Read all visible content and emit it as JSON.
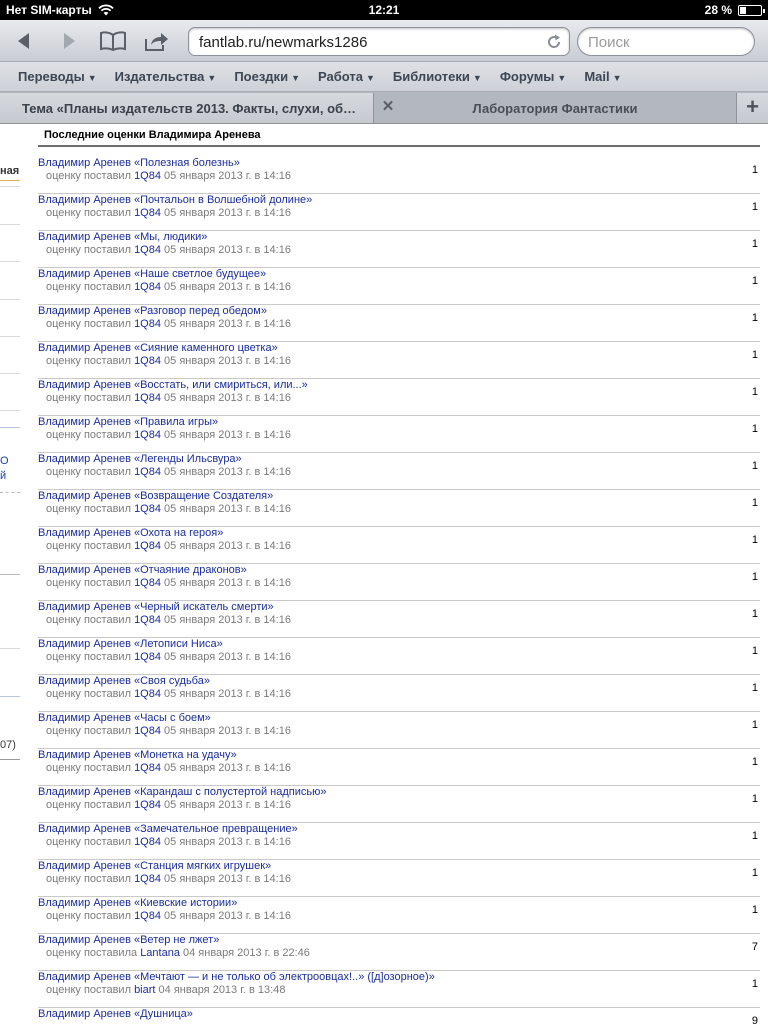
{
  "statusbar": {
    "carrier": "Нет SIM-карты",
    "time": "12:21",
    "battery_text": "28 %",
    "battery_level": 0.28
  },
  "toolbar": {
    "url": "fantlab.ru/newmarks1286",
    "search_placeholder": "Поиск",
    "icons": [
      "back-arrow-icon",
      "forward-arrow-icon",
      "bookmarks-book-icon",
      "share-icon",
      "reload-icon"
    ]
  },
  "bookmarks": [
    {
      "label": "Переводы",
      "caret": "▼"
    },
    {
      "label": "Издательства",
      "caret": "▼"
    },
    {
      "label": "Поездки",
      "caret": "▼"
    },
    {
      "label": "Работа",
      "caret": "▼"
    },
    {
      "label": "Библиотеки",
      "caret": "▼"
    },
    {
      "label": "Форумы",
      "caret": "▼"
    },
    {
      "label": "Mail",
      "caret": "▼"
    }
  ],
  "tabs": {
    "active": "Тема «Планы издательств 2013. Факты, слухи, об…",
    "other": "Лаборатория Фантастики",
    "close_glyph": "✕",
    "add_glyph": "+"
  },
  "left_fragments": {
    "label_top": "ная",
    "label_blue_1": "О",
    "label_blue_2": "й",
    "label_bottom": "07)"
  },
  "main": {
    "heading": "Последние оценки Владимира Аренева",
    "rows": [
      {
        "title": "Владимир Аренев «Полезная болезнь»",
        "prefix": "оценку поставил",
        "user": "1Q84",
        "date": "05 января 2013 г. в 14:16",
        "score": "1"
      },
      {
        "title": "Владимир Аренев «Почтальон в Волшебной долине»",
        "prefix": "оценку поставил",
        "user": "1Q84",
        "date": "05 января 2013 г. в 14:16",
        "score": "1"
      },
      {
        "title": "Владимир Аренев «Мы, людики»",
        "prefix": "оценку поставил",
        "user": "1Q84",
        "date": "05 января 2013 г. в 14:16",
        "score": "1"
      },
      {
        "title": "Владимир Аренев «Наше светлое будущее»",
        "prefix": "оценку поставил",
        "user": "1Q84",
        "date": "05 января 2013 г. в 14:16",
        "score": "1"
      },
      {
        "title": "Владимир Аренев «Разговор перед обедом»",
        "prefix": "оценку поставил",
        "user": "1Q84",
        "date": "05 января 2013 г. в 14:16",
        "score": "1"
      },
      {
        "title": "Владимир Аренев «Сияние каменного цветка»",
        "prefix": "оценку поставил",
        "user": "1Q84",
        "date": "05 января 2013 г. в 14:16",
        "score": "1"
      },
      {
        "title": "Владимир Аренев «Восстать, или смириться, или...»",
        "prefix": "оценку поставил",
        "user": "1Q84",
        "date": "05 января 2013 г. в 14:16",
        "score": "1"
      },
      {
        "title": "Владимир Аренев «Правила игры»",
        "prefix": "оценку поставил",
        "user": "1Q84",
        "date": "05 января 2013 г. в 14:16",
        "score": "1"
      },
      {
        "title": "Владимир Аренев «Легенды Ильсвура»",
        "prefix": "оценку поставил",
        "user": "1Q84",
        "date": "05 января 2013 г. в 14:16",
        "score": "1"
      },
      {
        "title": "Владимир Аренев «Возвращение Создателя»",
        "prefix": "оценку поставил",
        "user": "1Q84",
        "date": "05 января 2013 г. в 14:16",
        "score": "1"
      },
      {
        "title": "Владимир Аренев «Охота на героя»",
        "prefix": "оценку поставил",
        "user": "1Q84",
        "date": "05 января 2013 г. в 14:16",
        "score": "1"
      },
      {
        "title": "Владимир Аренев «Отчаяние драконов»",
        "prefix": "оценку поставил",
        "user": "1Q84",
        "date": "05 января 2013 г. в 14:16",
        "score": "1"
      },
      {
        "title": "Владимир Аренев «Черный искатель смерти»",
        "prefix": "оценку поставил",
        "user": "1Q84",
        "date": "05 января 2013 г. в 14:16",
        "score": "1"
      },
      {
        "title": "Владимир Аренев «Летописи Ниса»",
        "prefix": "оценку поставил",
        "user": "1Q84",
        "date": "05 января 2013 г. в 14:16",
        "score": "1"
      },
      {
        "title": "Владимир Аренев «Своя судьба»",
        "prefix": "оценку поставил",
        "user": "1Q84",
        "date": "05 января 2013 г. в 14:16",
        "score": "1"
      },
      {
        "title": "Владимир Аренев «Часы с боем»",
        "prefix": "оценку поставил",
        "user": "1Q84",
        "date": "05 января 2013 г. в 14:16",
        "score": "1"
      },
      {
        "title": "Владимир Аренев «Монетка на удачу»",
        "prefix": "оценку поставил",
        "user": "1Q84",
        "date": "05 января 2013 г. в 14:16",
        "score": "1"
      },
      {
        "title": "Владимир Аренев «Карандаш с полустертой надписью»",
        "prefix": "оценку поставил",
        "user": "1Q84",
        "date": "05 января 2013 г. в 14:16",
        "score": "1"
      },
      {
        "title": "Владимир Аренев «Замечательное превращение»",
        "prefix": "оценку поставил",
        "user": "1Q84",
        "date": "05 января 2013 г. в 14:16",
        "score": "1"
      },
      {
        "title": "Владимир Аренев «Станция мягких игрушек»",
        "prefix": "оценку поставил",
        "user": "1Q84",
        "date": "05 января 2013 г. в 14:16",
        "score": "1"
      },
      {
        "title": "Владимир Аренев «Киевские истории»",
        "prefix": "оценку поставил",
        "user": "1Q84",
        "date": "05 января 2013 г. в 14:16",
        "score": "1"
      },
      {
        "title": "Владимир Аренев «Ветер не лжет»",
        "prefix": "оценку поставила",
        "user": "Lantana",
        "date": "04 января 2013 г. в 22:46",
        "score": "7"
      },
      {
        "title": "Владимир Аренев «Мечтают — и не только об электроовцах!..» ([д]озорное)»",
        "prefix": "оценку поставил",
        "user": "biart",
        "date": "04 января 2013 г. в 13:48",
        "score": "1"
      },
      {
        "title": "Владимир Аренев «Душница»",
        "prefix": "",
        "user": "",
        "date": "",
        "score": "9"
      }
    ]
  }
}
